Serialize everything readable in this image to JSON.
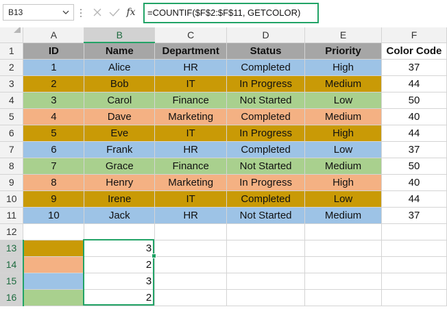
{
  "formula_bar": {
    "name_box": "B13",
    "formula": "=COUNTIF($F$2:$F$11, GETCOLOR)"
  },
  "colors": {
    "blue": "#9dc3e6",
    "gold": "#c99a06",
    "green": "#a9d08e",
    "orange": "#f4b183",
    "header_gray": "#a6a6a6",
    "selection_green": "#21a366"
  },
  "columns": [
    "A",
    "B",
    "C",
    "D",
    "E",
    "F"
  ],
  "rows": [
    "1",
    "2",
    "3",
    "4",
    "5",
    "6",
    "7",
    "8",
    "9",
    "10",
    "11",
    "12",
    "13",
    "14",
    "15",
    "16"
  ],
  "headers": [
    "ID",
    "Name",
    "Department",
    "Status",
    "Priority",
    "Color Code"
  ],
  "data": [
    {
      "id": "1",
      "name": "Alice",
      "dept": "HR",
      "status": "Completed",
      "priority": "High",
      "code": "37",
      "fill": "blue"
    },
    {
      "id": "2",
      "name": "Bob",
      "dept": "IT",
      "status": "In Progress",
      "priority": "Medium",
      "code": "44",
      "fill": "gold"
    },
    {
      "id": "3",
      "name": "Carol",
      "dept": "Finance",
      "status": "Not Started",
      "priority": "Low",
      "code": "50",
      "fill": "green"
    },
    {
      "id": "4",
      "name": "Dave",
      "dept": "Marketing",
      "status": "Completed",
      "priority": "Medium",
      "code": "40",
      "fill": "orange"
    },
    {
      "id": "5",
      "name": "Eve",
      "dept": "IT",
      "status": "In Progress",
      "priority": "High",
      "code": "44",
      "fill": "gold"
    },
    {
      "id": "6",
      "name": "Frank",
      "dept": "HR",
      "status": "Completed",
      "priority": "Low",
      "code": "37",
      "fill": "blue"
    },
    {
      "id": "7",
      "name": "Grace",
      "dept": "Finance",
      "status": "Not Started",
      "priority": "Medium",
      "code": "50",
      "fill": "green"
    },
    {
      "id": "8",
      "name": "Henry",
      "dept": "Marketing",
      "status": "In Progress",
      "priority": "High",
      "code": "40",
      "fill": "orange"
    },
    {
      "id": "9",
      "name": "Irene",
      "dept": "IT",
      "status": "Completed",
      "priority": "Low",
      "code": "44",
      "fill": "gold"
    },
    {
      "id": "10",
      "name": "Jack",
      "dept": "HR",
      "status": "Not Started",
      "priority": "Medium",
      "code": "37",
      "fill": "blue"
    }
  ],
  "summary": [
    {
      "fill": "gold",
      "count": "3"
    },
    {
      "fill": "orange",
      "count": "2"
    },
    {
      "fill": "blue",
      "count": "3"
    },
    {
      "fill": "green",
      "count": "2"
    }
  ]
}
